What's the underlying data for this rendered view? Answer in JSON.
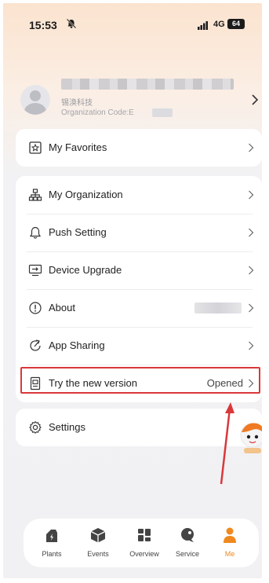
{
  "status_bar": {
    "time": "15:53",
    "network": "4G",
    "battery": "64"
  },
  "profile": {
    "org_name": "锡涣科技",
    "org_code_label": "Organization Code:E"
  },
  "menu": {
    "favorites": {
      "label": "My Favorites",
      "icon": "star-box-icon"
    },
    "items": [
      {
        "label": "My Organization",
        "icon": "org-chart-icon"
      },
      {
        "label": "Push Setting",
        "icon": "bell-icon"
      },
      {
        "label": "Device Upgrade",
        "icon": "monitor-upgrade-icon"
      },
      {
        "label": "About",
        "icon": "info-icon"
      },
      {
        "label": "App Sharing",
        "icon": "share-icon"
      },
      {
        "label": "Try the new version",
        "icon": "document-icon",
        "value": "Opened"
      }
    ],
    "settings": {
      "label": "Settings",
      "icon": "gear-icon"
    }
  },
  "tabbar": {
    "tabs": [
      {
        "label": "Plants",
        "icon": "plant-icon"
      },
      {
        "label": "Events",
        "icon": "events-icon"
      },
      {
        "label": "Overview",
        "icon": "grid-icon"
      },
      {
        "label": "Service",
        "icon": "service-icon"
      },
      {
        "label": "Me",
        "icon": "person-icon",
        "active": true
      }
    ]
  },
  "colors": {
    "accent": "#f08a1e",
    "highlight": "#d9383a"
  }
}
